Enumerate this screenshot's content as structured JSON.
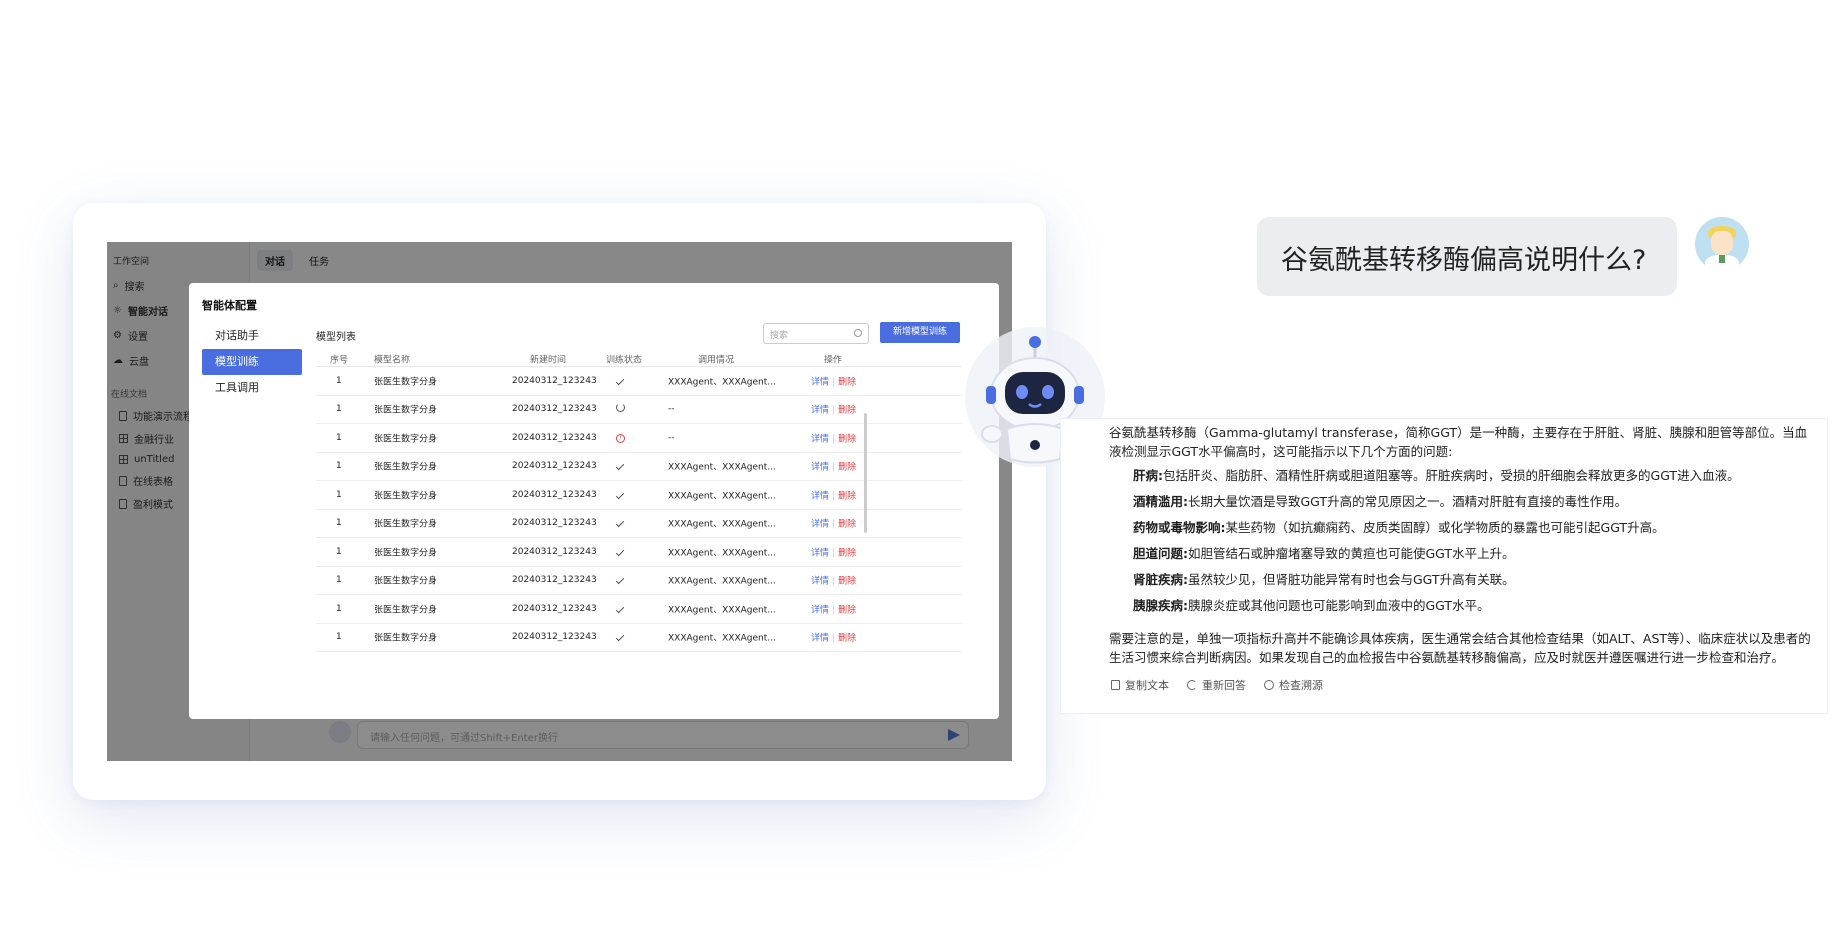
{
  "app": {
    "workspace": "工作空间",
    "nav": [
      "搜索",
      "智能对话",
      "设置",
      "云盘"
    ],
    "docs_section": "在线文档",
    "docs": [
      "功能演示流程",
      "金融行业",
      "unTitled",
      "在线表格",
      "盈利模式"
    ],
    "tabs": [
      "对话",
      "任务"
    ],
    "input_placeholder": "请输入任何问题，可通过Shift+Enter换行"
  },
  "modal": {
    "title": "智能体配置",
    "menu": [
      "对话助手",
      "模型训练",
      "工具调用"
    ],
    "list_title": "模型列表",
    "search_placeholder": "搜索",
    "new_button": "新增模型训练",
    "columns": [
      "序号",
      "模型名称",
      "新建时间",
      "训练状态",
      "调用情况",
      "操作"
    ],
    "rows": [
      {
        "no": "1",
        "name": "张医生数字分身",
        "time": "20240312_123243",
        "status": "done",
        "call": "XXXAgent、XXXAgent..."
      },
      {
        "no": "1",
        "name": "张医生数字分身",
        "time": "20240312_123243",
        "status": "running",
        "call": "--"
      },
      {
        "no": "1",
        "name": "张医生数字分身",
        "time": "20240312_123243",
        "status": "error",
        "call": "--"
      },
      {
        "no": "1",
        "name": "张医生数字分身",
        "time": "20240312_123243",
        "status": "done",
        "call": "XXXAgent、XXXAgent..."
      },
      {
        "no": "1",
        "name": "张医生数字分身",
        "time": "20240312_123243",
        "status": "done",
        "call": "XXXAgent、XXXAgent..."
      },
      {
        "no": "1",
        "name": "张医生数字分身",
        "time": "20240312_123243",
        "status": "done",
        "call": "XXXAgent、XXXAgent..."
      },
      {
        "no": "1",
        "name": "张医生数字分身",
        "time": "20240312_123243",
        "status": "done",
        "call": "XXXAgent、XXXAgent..."
      },
      {
        "no": "1",
        "name": "张医生数字分身",
        "time": "20240312_123243",
        "status": "done",
        "call": "XXXAgent、XXXAgent..."
      },
      {
        "no": "1",
        "name": "张医生数字分身",
        "time": "20240312_123243",
        "status": "done",
        "call": "XXXAgent、XXXAgent..."
      },
      {
        "no": "1",
        "name": "张医生数字分身",
        "time": "20240312_123243",
        "status": "done",
        "call": "XXXAgent、XXXAgent..."
      }
    ],
    "op_detail": "详情",
    "op_delete": "删除"
  },
  "chat": {
    "question": "谷氨酰基转移酶偏高说明什么?",
    "intro": "谷氨酰基转移酶（Gamma-glutamyl transferase，简称GGT）是一种酶，主要存在于肝脏、肾脏、胰腺和胆管等部位。当血液检测显示GGT水平偏高时，这可能指示以下几个方面的问题:",
    "items": [
      {
        "term": "肝病:",
        "text": "包括肝炎、脂肪肝、酒精性肝病或胆道阻塞等。肝脏疾病时，受损的肝细胞会释放更多的GGT进入血液。"
      },
      {
        "term": "酒精滥用:",
        "text": "长期大量饮酒是导致GGT升高的常见原因之一。酒精对肝脏有直接的毒性作用。"
      },
      {
        "term": "药物或毒物影响:",
        "text": "某些药物（如抗癫痫药、皮质类固醇）或化学物质的暴露也可能引起GGT升高。"
      },
      {
        "term": "胆道问题:",
        "text": "如胆管结石或肿瘤堵塞导致的黄疸也可能使GGT水平上升。"
      },
      {
        "term": "肾脏疾病:",
        "text": "虽然较少见，但肾脏功能异常有时也会与GGT升高有关联。"
      },
      {
        "term": "胰腺疾病:",
        "text": "胰腺炎症或其他问题也可能影响到血液中的GGT水平。"
      }
    ],
    "conclusion": "需要注意的是，单独一项指标升高并不能确诊具体疾病，医生通常会结合其他检查结果（如ALT、AST等）、临床症状以及患者的生活习惯来综合判断病因。如果发现自己的血检报告中谷氨酰基转移酶偏高，应及时就医并遵医嘱进行进一步检查和治疗。",
    "actions": [
      "复制文本",
      "重新回答",
      "检查溯源"
    ]
  },
  "colors": {
    "accent": "#4a6ee0",
    "danger": "#e04040",
    "bubble": "#ebedf1"
  }
}
